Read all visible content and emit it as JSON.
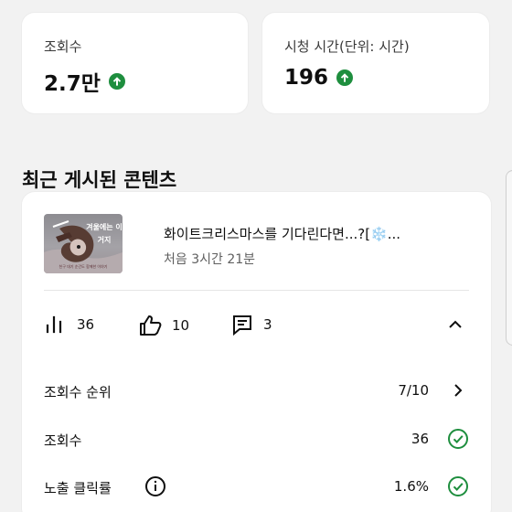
{
  "stats": {
    "views": {
      "label": "조회수",
      "value": "2.7만",
      "trend_icon": "arrow-up-circle-icon",
      "trend_color": "#1e8e3e"
    },
    "watch_time": {
      "label": "시청 시간(단위: 시간)",
      "value": "196",
      "trend_icon": "arrow-up-circle-icon",
      "trend_color": "#1e8e3e"
    }
  },
  "recent_content": {
    "title": "최근 게시된 콘텐츠",
    "video": {
      "thumbnail_text": "겨울에는 이거지",
      "thumbnail_caption": "친구 대기 순간도 함께한 이야기",
      "title": "화이트크리스마스를 기다린다면...?[❄️...",
      "time": "처음 3시간 21분"
    },
    "metrics": {
      "views": "36",
      "likes": "10",
      "comments": "3"
    },
    "details": [
      {
        "label": "조회수 순위",
        "value": "7/10",
        "icon": "chevron-right-icon"
      },
      {
        "label": "조회수",
        "value": "36",
        "icon": "check-circle-icon"
      },
      {
        "label": "노출 클릭률",
        "value": "1.6%",
        "icon": "check-circle-icon",
        "info_icon": "info-icon"
      }
    ]
  },
  "colors": {
    "background": "#f2f2f2",
    "card": "#ffffff",
    "text": "#0f0f0f",
    "secondary_text": "#606060",
    "success": "#1e8e3e"
  }
}
